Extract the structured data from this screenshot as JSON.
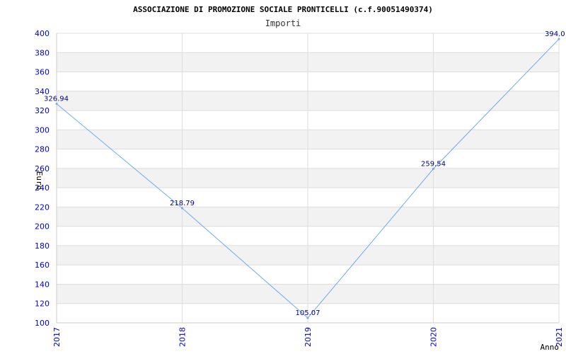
{
  "chart_data": {
    "type": "line",
    "title": "ASSOCIAZIONE DI PROMOZIONE SOCIALE PRONTICELLI (c.f.90051490374)",
    "subtitle": "Importi",
    "xlabel": "Anno",
    "ylabel": "Euro",
    "categories": [
      "2017",
      "2018",
      "2019",
      "2020",
      "2021"
    ],
    "series": [
      {
        "values": [
          326.94,
          218.79,
          105.07,
          259.54,
          394.0
        ],
        "labels": [
          "326.94",
          "218.79",
          "105.07",
          "259.54",
          "394.0"
        ]
      }
    ],
    "ylim": [
      100,
      400
    ],
    "yticks": [
      100,
      120,
      140,
      160,
      180,
      200,
      220,
      240,
      260,
      280,
      300,
      320,
      340,
      360,
      380,
      400
    ],
    "grid": true,
    "legend": "none",
    "colors": {
      "line": "#6fa8f0",
      "band": "#f2f2f2",
      "grid": "#dddddd",
      "tick_text": "#0000cc",
      "data_label": "#000080"
    }
  }
}
